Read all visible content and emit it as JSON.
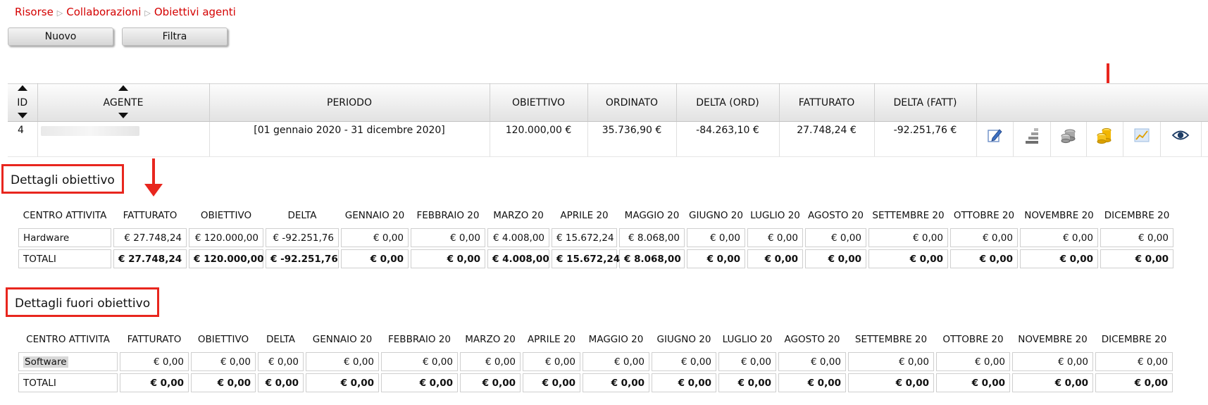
{
  "breadcrumb": {
    "items": [
      "Risorse",
      "Collaborazioni",
      "Obiettivi agenti"
    ],
    "separator": "▷"
  },
  "toolbar": {
    "new_label": "Nuovo",
    "filter_label": "Filtra"
  },
  "list": {
    "columns": [
      "ID",
      "AGENTE",
      "PERIODO",
      "OBIETTIVO",
      "ORDINATO",
      "DELTA (ORD)",
      "FATTURATO",
      "DELTA (FATT)"
    ],
    "rows": [
      {
        "id": "4",
        "agente": "",
        "periodo": "[01 gennaio 2020 - 31 dicembre 2020]",
        "obiettivo": "120.000,00 €",
        "ordinato": "35.736,90 €",
        "delta_ord": "-84.263,10 €",
        "fatturato": "27.748,24 €",
        "delta_fatt": "-92.251,76 €"
      }
    ],
    "actions": [
      "edit-pencil-icon",
      "bar-chart-icon",
      "coins-stack-gray-icon",
      "coins-stack-gold-icon",
      "line-chart-icon",
      "eye-icon"
    ]
  },
  "colors": {
    "accent_red": "#e8261e",
    "breadcrumb_red": "#d40000"
  },
  "details": {
    "title": "Dettagli obiettivo",
    "headers": [
      "CENTRO ATTIVITA",
      "FATTURATO",
      "OBIETTIVO",
      "DELTA",
      "GENNAIO 20",
      "FEBBRAIO 20",
      "MARZO 20",
      "APRILE 20",
      "MAGGIO 20",
      "GIUGNO 20",
      "LUGLIO 20",
      "AGOSTO 20",
      "SETTEMBRE 20",
      "OTTOBRE 20",
      "NOVEMBRE 20",
      "DICEMBRE 20"
    ],
    "rows": [
      [
        "Hardware",
        "€ 27.748,24",
        "€ 120.000,00",
        "€ -92.251,76",
        "€ 0,00",
        "€ 0,00",
        "€ 4.008,00",
        "€ 15.672,24",
        "€ 8.068,00",
        "€ 0,00",
        "€ 0,00",
        "€ 0,00",
        "€ 0,00",
        "€ 0,00",
        "€ 0,00",
        "€ 0,00"
      ],
      [
        "TOTALI",
        "€ 27.748,24",
        "€ 120.000,00",
        "€ -92.251,76",
        "€ 0,00",
        "€ 0,00",
        "€ 4.008,00",
        "€ 15.672,24",
        "€ 8.068,00",
        "€ 0,00",
        "€ 0,00",
        "€ 0,00",
        "€ 0,00",
        "€ 0,00",
        "€ 0,00",
        "€ 0,00"
      ]
    ]
  },
  "outside": {
    "title": "Dettagli fuori obiettivo",
    "headers": [
      "CENTRO ATTIVITA",
      "FATTURATO",
      "OBIETTIVO",
      "DELTA",
      "GENNAIO 20",
      "FEBBRAIO 20",
      "MARZO 20",
      "APRILE 20",
      "MAGGIO 20",
      "GIUGNO 20",
      "LUGLIO 20",
      "AGOSTO 20",
      "SETTEMBRE 20",
      "OTTOBRE 20",
      "NOVEMBRE 20",
      "DICEMBRE 20"
    ],
    "rows": [
      [
        "Software",
        "€ 0,00",
        "€ 0,00",
        "€ 0,00",
        "€ 0,00",
        "€ 0,00",
        "€ 0,00",
        "€ 0,00",
        "€ 0,00",
        "€ 0,00",
        "€ 0,00",
        "€ 0,00",
        "€ 0,00",
        "€ 0,00",
        "€ 0,00",
        "€ 0,00"
      ],
      [
        "TOTALI",
        "€ 0,00",
        "€ 0,00",
        "€ 0,00",
        "€ 0,00",
        "€ 0,00",
        "€ 0,00",
        "€ 0,00",
        "€ 0,00",
        "€ 0,00",
        "€ 0,00",
        "€ 0,00",
        "€ 0,00",
        "€ 0,00",
        "€ 0,00",
        "€ 0,00"
      ]
    ]
  }
}
